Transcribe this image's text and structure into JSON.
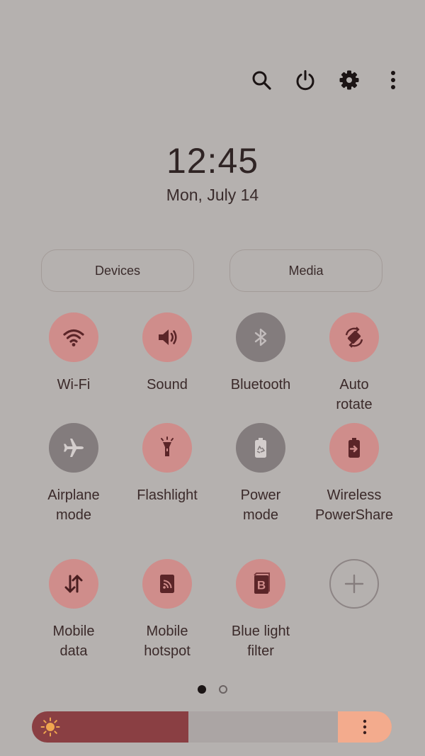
{
  "clock": {
    "time": "12:45",
    "date": "Mon, July 14"
  },
  "top_actions": [
    {
      "name": "search-icon"
    },
    {
      "name": "power-icon"
    },
    {
      "name": "gear-icon"
    },
    {
      "name": "more-vertical-icon"
    }
  ],
  "pills": {
    "devices": "Devices",
    "media": "Media"
  },
  "tiles": [
    {
      "label": "Wi-Fi",
      "state": "on",
      "icon": "wifi-icon"
    },
    {
      "label": "Sound",
      "state": "on",
      "icon": "sound-icon"
    },
    {
      "label": "Bluetooth",
      "state": "off",
      "icon": "bluetooth-icon"
    },
    {
      "label": "Auto\nrotate",
      "state": "on",
      "icon": "auto-rotate-icon"
    },
    {
      "label": "Airplane\nmode",
      "state": "off",
      "icon": "airplane-icon"
    },
    {
      "label": "Flashlight",
      "state": "on",
      "icon": "flashlight-icon"
    },
    {
      "label": "Power\nmode",
      "state": "off",
      "icon": "battery-recycle-icon"
    },
    {
      "label": "Wireless\nPowerShare",
      "state": "on",
      "icon": "wireless-powershare-icon"
    },
    {
      "label": "Mobile\ndata",
      "state": "on",
      "icon": "mobile-data-icon"
    },
    {
      "label": "Mobile\nhotspot",
      "state": "on",
      "icon": "hotspot-icon"
    },
    {
      "label": "Blue light\nfilter",
      "state": "on",
      "icon": "blue-light-filter-icon"
    },
    {
      "label": "",
      "state": "add",
      "icon": "plus-icon"
    }
  ],
  "pager": {
    "pages": 2,
    "current": 1
  },
  "brightness": {
    "level": 0.45
  },
  "colors": {
    "on": "#cf8d8b",
    "off": "#837c7d",
    "background": "#b5b1af",
    "brightness_fill": "#8a3f43",
    "brightness_end": "#f3ab8d"
  }
}
